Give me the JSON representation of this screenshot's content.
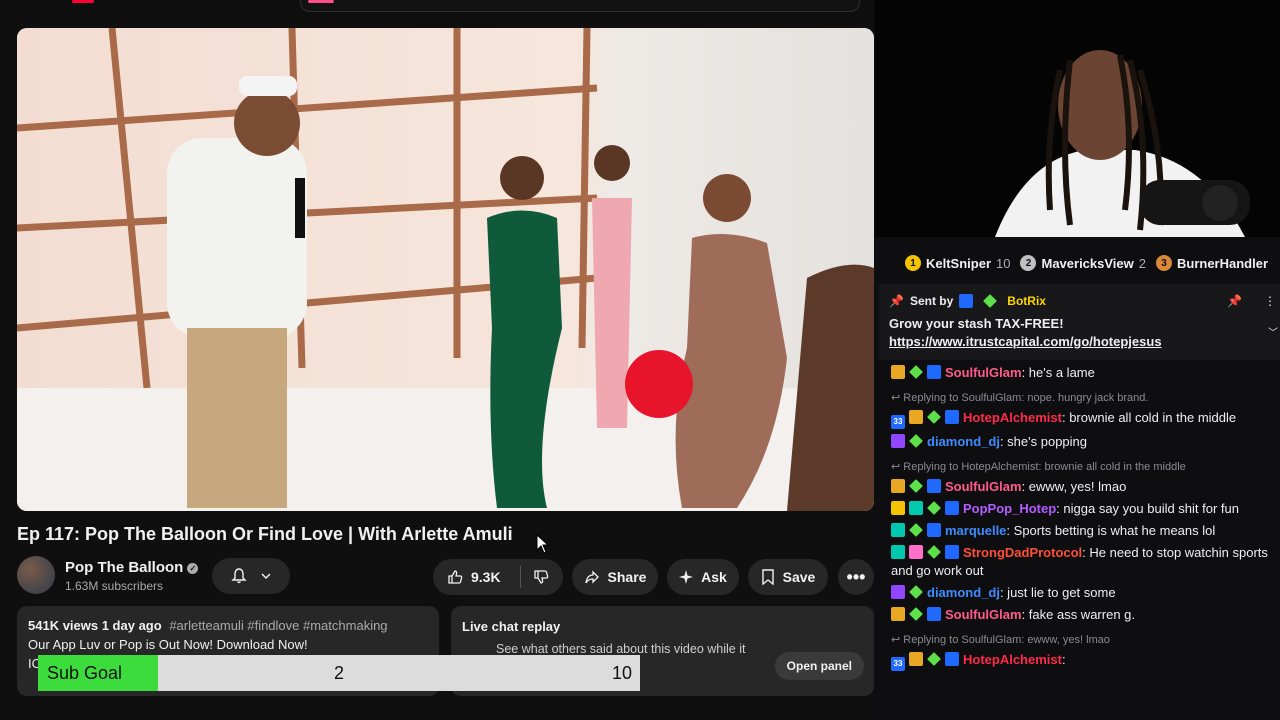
{
  "video": {
    "title": "Ep 117: Pop The Balloon Or Find Love | With Arlette Amuli",
    "channel_name": "Pop The Balloon",
    "subscribers": "1.63M subscribers",
    "likes": "9.3K",
    "share_label": "Share",
    "ask_label": "Ask",
    "save_label": "Save"
  },
  "description": {
    "meta": "541K views  1 day ago",
    "tags": "#arletteamuli #findlove #matchmaking",
    "line2": "Our App Luv or Pop is Out Now! Download Now!",
    "line3": "IO"
  },
  "live_chat": {
    "title": "Live chat replay",
    "subtitle": "See what others said about this video while it",
    "open_panel_label": "Open panel"
  },
  "sub_goal": {
    "label": "Sub Goal",
    "current": "2",
    "max": "10",
    "progress": 0.2
  },
  "leaderboard": [
    {
      "rank": "1",
      "name": "KeltSniper",
      "count": "10",
      "color": "#f5c400"
    },
    {
      "rank": "2",
      "name": "MavericksView",
      "count": "2",
      "color": "#c0c0c0"
    },
    {
      "rank": "3",
      "name": "BurnerHandler",
      "count": "",
      "color": "#d9883a"
    }
  ],
  "pinned": {
    "sent_by": "Sent by",
    "bot": "BotRix",
    "message": "Grow your stash TAX-FREE!",
    "link": "https://www.itrustcapital.com/go/hotepjesus"
  },
  "chat": [
    {
      "type": "msg",
      "badges": [
        "gift",
        "green",
        "mod"
      ],
      "user": "SoulfulGlam",
      "color": "#ff5a8c",
      "text": ": he's a lame"
    },
    {
      "type": "reply",
      "text": "Replying to SoulfulGlam: nope. hungry jack brand."
    },
    {
      "type": "msg",
      "badges": [
        "num",
        "gift",
        "green",
        "mod"
      ],
      "user": "HotepAlchemist",
      "color": "#ff2a4a",
      "text": ": brownie all cold in the middle"
    },
    {
      "type": "msg",
      "badges": [
        "purple",
        "green"
      ],
      "user": "diamond_dj",
      "color": "#3e8cff",
      "text": ": she's popping"
    },
    {
      "type": "reply",
      "text": "Replying to HotepAlchemist: brownie all cold in the middle"
    },
    {
      "type": "msg",
      "badges": [
        "gift",
        "green",
        "mod"
      ],
      "user": "SoulfulGlam",
      "color": "#ff5a8c",
      "text": ": ewww, yes! lmao"
    },
    {
      "type": "msg",
      "badges": [
        "crown",
        "teal",
        "green",
        "mod"
      ],
      "user": "PopPop_Hotep",
      "color": "#b45cff",
      "text": ": nigga say you build shit for fun"
    },
    {
      "type": "msg",
      "badges": [
        "teal",
        "green",
        "mod"
      ],
      "user": "marquelle",
      "color": "#3e8cff",
      "text": ": Sports betting is what he means lol"
    },
    {
      "type": "msg",
      "badges": [
        "teal",
        "pink",
        "green",
        "mod"
      ],
      "user": "StrongDadProtocol",
      "color": "#ff4f3a",
      "text": ": He need to stop watchin sports and go work out"
    },
    {
      "type": "msg",
      "badges": [
        "purple",
        "green"
      ],
      "user": "diamond_dj",
      "color": "#3e8cff",
      "text": ": just lie to get some"
    },
    {
      "type": "msg",
      "badges": [
        "gift",
        "green",
        "mod"
      ],
      "user": "SoulfulGlam",
      "color": "#ff5a8c",
      "text": ": fake ass warren g."
    },
    {
      "type": "reply",
      "text": "Replying to SoulfulGlam: ewww, yes! lmao"
    },
    {
      "type": "msg",
      "badges": [
        "num",
        "gift",
        "green",
        "mod"
      ],
      "user": "HotepAlchemist",
      "color": "#ff2a4a",
      "text": ":"
    }
  ]
}
